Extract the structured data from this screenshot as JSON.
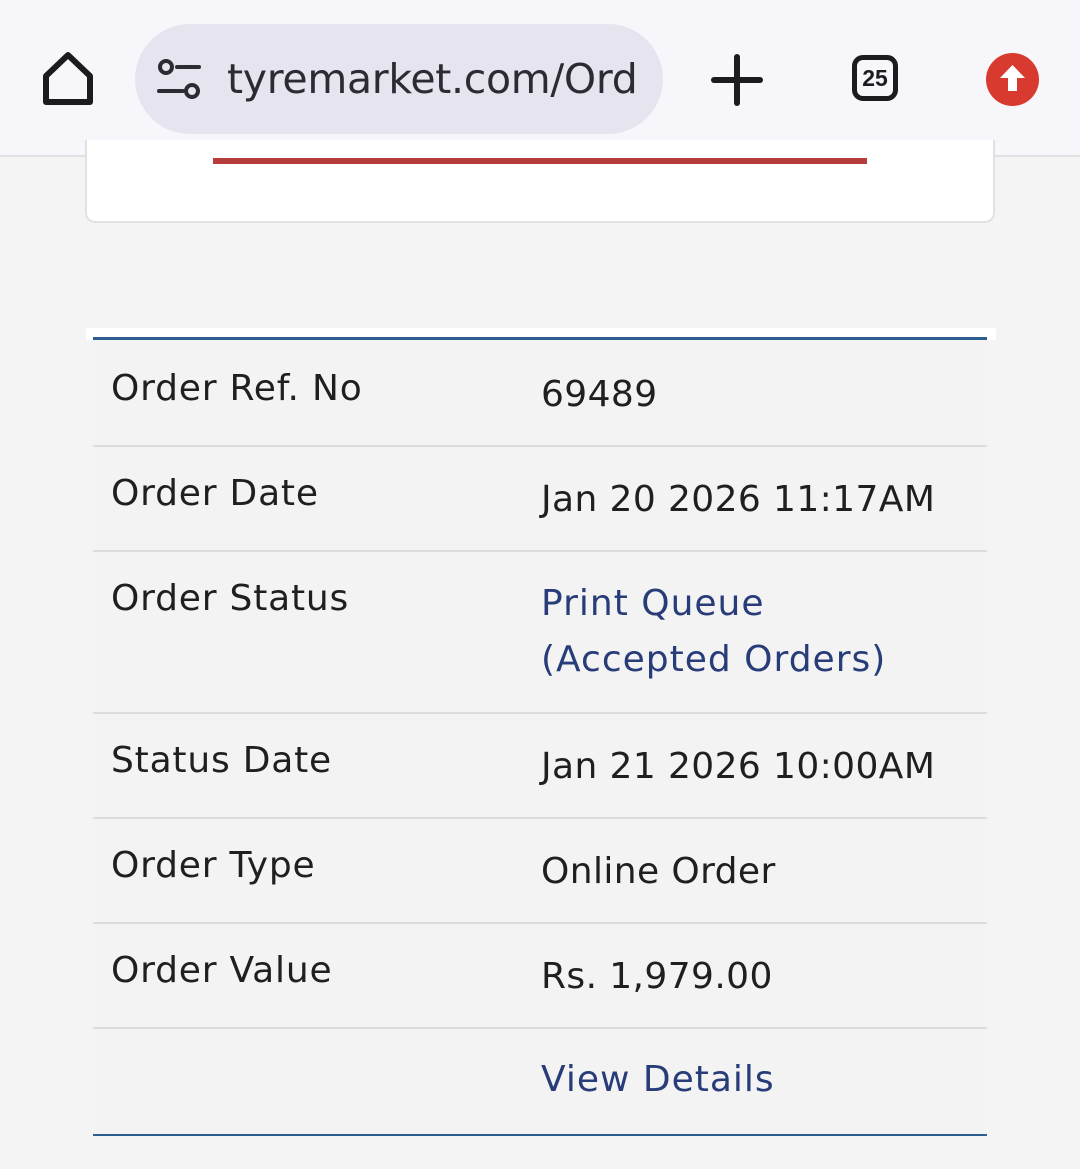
{
  "browser": {
    "url": "tyremarket.com/Ord",
    "tab_count": "25",
    "icons": {
      "home": "home-icon",
      "site_settings": "tune-icon",
      "new_tab": "plus-icon",
      "update": "update-arrow-icon"
    },
    "accent_color": "#d93a2f"
  },
  "order": {
    "rows": [
      {
        "label": "Order Ref. No",
        "value": "69489"
      },
      {
        "label": "Order Date",
        "value": "Jan 20 2026 11:17AM"
      },
      {
        "label": "Order Status",
        "value": "Print Queue (Accepted Orders)"
      },
      {
        "label": "Status Date",
        "value": "Jan 21 2026 10:00AM"
      },
      {
        "label": "Order Type",
        "value": "Online Order"
      },
      {
        "label": "Order Value",
        "value": "Rs. 1,979.00"
      }
    ],
    "view_details_label": "View Details"
  },
  "colors": {
    "table_border": "#2b5d8f",
    "link": "#273c78",
    "card_accent": "#b73d3d"
  }
}
